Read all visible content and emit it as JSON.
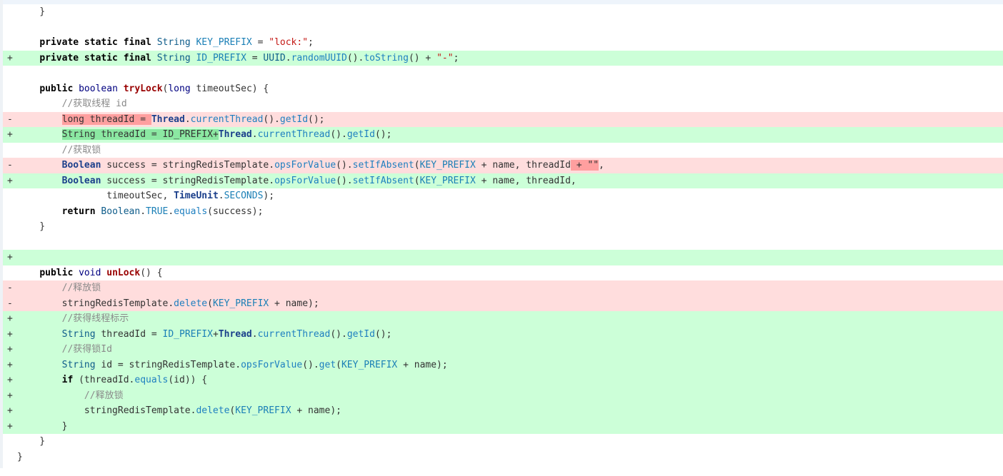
{
  "diff": {
    "lines": [
      {
        "type": "ctx",
        "sign": "",
        "tokens": [
          {
            "t": "    }"
          }
        ]
      },
      {
        "type": "ctx",
        "sign": "",
        "tokens": [
          {
            "t": ""
          }
        ]
      },
      {
        "type": "ctx",
        "sign": "",
        "tokens": [
          {
            "t": "    "
          },
          {
            "t": "private static final ",
            "c": "kw"
          },
          {
            "t": "String",
            "c": "ty"
          },
          {
            "t": " "
          },
          {
            "t": "KEY_PREFIX",
            "c": "cst"
          },
          {
            "t": " = "
          },
          {
            "t": "\"lock:\"",
            "c": "str"
          },
          {
            "t": ";"
          }
        ]
      },
      {
        "type": "add",
        "sign": "+",
        "tokens": [
          {
            "t": "    "
          },
          {
            "t": "private static final ",
            "c": "kw"
          },
          {
            "t": "String",
            "c": "ty"
          },
          {
            "t": " "
          },
          {
            "t": "ID_PREFIX",
            "c": "cst"
          },
          {
            "t": " = "
          },
          {
            "t": "UUID",
            "c": "ty"
          },
          {
            "t": "."
          },
          {
            "t": "randomUUID",
            "c": "mth"
          },
          {
            "t": "()."
          },
          {
            "t": "toString",
            "c": "mth"
          },
          {
            "t": "() + "
          },
          {
            "t": "\"-\"",
            "c": "str"
          },
          {
            "t": ";"
          }
        ]
      },
      {
        "type": "ctx",
        "sign": "",
        "tokens": [
          {
            "t": ""
          }
        ]
      },
      {
        "type": "ctx",
        "sign": "",
        "tokens": [
          {
            "t": "    "
          },
          {
            "t": "public ",
            "c": "kw"
          },
          {
            "t": "boolean",
            "c": "kwl"
          },
          {
            "t": " "
          },
          {
            "t": "tryLock",
            "c": "fn"
          },
          {
            "t": "("
          },
          {
            "t": "long",
            "c": "kwl"
          },
          {
            "t": " timeoutSec) {"
          }
        ]
      },
      {
        "type": "ctx",
        "sign": "",
        "tokens": [
          {
            "t": "        "
          },
          {
            "t": "//获取线程 id",
            "c": "cmt"
          }
        ]
      },
      {
        "type": "del",
        "sign": "-",
        "tokens": [
          {
            "t": "        "
          },
          {
            "t": "long threadId = ",
            "c": "hl-del"
          },
          {
            "t": "Thread",
            "c": "cls"
          },
          {
            "t": "."
          },
          {
            "t": "currentThread",
            "c": "mth"
          },
          {
            "t": "()."
          },
          {
            "t": "getId",
            "c": "mth"
          },
          {
            "t": "();"
          }
        ]
      },
      {
        "type": "add",
        "sign": "+",
        "tokens": [
          {
            "t": "        "
          },
          {
            "t": "String threadId = ID_PREFIX+",
            "c": "hl-add"
          },
          {
            "t": "Thread",
            "c": "cls"
          },
          {
            "t": "."
          },
          {
            "t": "currentThread",
            "c": "mth"
          },
          {
            "t": "()."
          },
          {
            "t": "getId",
            "c": "mth"
          },
          {
            "t": "();"
          }
        ]
      },
      {
        "type": "ctx",
        "sign": "",
        "tokens": [
          {
            "t": "        "
          },
          {
            "t": "//获取锁",
            "c": "cmt"
          }
        ]
      },
      {
        "type": "del",
        "sign": "-",
        "tokens": [
          {
            "t": "        "
          },
          {
            "t": "Boolean",
            "c": "cls"
          },
          {
            "t": " success = stringRedisTemplate."
          },
          {
            "t": "opsForValue",
            "c": "mth"
          },
          {
            "t": "()."
          },
          {
            "t": "setIfAbsent",
            "c": "mth"
          },
          {
            "t": "("
          },
          {
            "t": "KEY_PREFIX",
            "c": "cst"
          },
          {
            "t": " + name, threadId"
          },
          {
            "t": " + \"\"",
            "c": "hl-del"
          },
          {
            "t": ","
          }
        ]
      },
      {
        "type": "add",
        "sign": "+",
        "tokens": [
          {
            "t": "        "
          },
          {
            "t": "Boolean",
            "c": "cls"
          },
          {
            "t": " success = stringRedisTemplate."
          },
          {
            "t": "opsForValue",
            "c": "mth"
          },
          {
            "t": "()."
          },
          {
            "t": "setIfAbsent",
            "c": "mth"
          },
          {
            "t": "("
          },
          {
            "t": "KEY_PREFIX",
            "c": "cst"
          },
          {
            "t": " + name, threadId,"
          }
        ]
      },
      {
        "type": "ctx",
        "sign": "",
        "tokens": [
          {
            "t": "                timeoutSec, "
          },
          {
            "t": "TimeUnit",
            "c": "cls"
          },
          {
            "t": "."
          },
          {
            "t": "SECONDS",
            "c": "cst"
          },
          {
            "t": ");"
          }
        ]
      },
      {
        "type": "ctx",
        "sign": "",
        "tokens": [
          {
            "t": "        "
          },
          {
            "t": "return ",
            "c": "kw"
          },
          {
            "t": "Boolean",
            "c": "ty"
          },
          {
            "t": "."
          },
          {
            "t": "TRUE",
            "c": "cst"
          },
          {
            "t": "."
          },
          {
            "t": "equals",
            "c": "mth"
          },
          {
            "t": "(success);"
          }
        ]
      },
      {
        "type": "ctx",
        "sign": "",
        "tokens": [
          {
            "t": "    }"
          }
        ]
      },
      {
        "type": "ctx",
        "sign": "",
        "tokens": [
          {
            "t": ""
          }
        ]
      },
      {
        "type": "add",
        "sign": "+",
        "tokens": [
          {
            "t": ""
          }
        ]
      },
      {
        "type": "ctx",
        "sign": "",
        "tokens": [
          {
            "t": "    "
          },
          {
            "t": "public ",
            "c": "kw"
          },
          {
            "t": "void",
            "c": "kwl"
          },
          {
            "t": " "
          },
          {
            "t": "unLock",
            "c": "fn"
          },
          {
            "t": "() {"
          }
        ]
      },
      {
        "type": "del",
        "sign": "-",
        "tokens": [
          {
            "t": "        "
          },
          {
            "t": "//释放锁",
            "c": "cmt"
          }
        ]
      },
      {
        "type": "del",
        "sign": "-",
        "tokens": [
          {
            "t": "        stringRedisTemplate."
          },
          {
            "t": "delete",
            "c": "mth"
          },
          {
            "t": "("
          },
          {
            "t": "KEY_PREFIX",
            "c": "cst"
          },
          {
            "t": " + name);"
          }
        ]
      },
      {
        "type": "add",
        "sign": "+",
        "tokens": [
          {
            "t": "        "
          },
          {
            "t": "//获得线程标示",
            "c": "cmt"
          }
        ]
      },
      {
        "type": "add",
        "sign": "+",
        "tokens": [
          {
            "t": "        "
          },
          {
            "t": "String",
            "c": "ty"
          },
          {
            "t": " threadId = "
          },
          {
            "t": "ID_PREFIX",
            "c": "cst"
          },
          {
            "t": "+"
          },
          {
            "t": "Thread",
            "c": "cls"
          },
          {
            "t": "."
          },
          {
            "t": "currentThread",
            "c": "mth"
          },
          {
            "t": "()."
          },
          {
            "t": "getId",
            "c": "mth"
          },
          {
            "t": "();"
          }
        ]
      },
      {
        "type": "add",
        "sign": "+",
        "tokens": [
          {
            "t": "        "
          },
          {
            "t": "//获得锁Id",
            "c": "cmt"
          }
        ]
      },
      {
        "type": "add",
        "sign": "+",
        "tokens": [
          {
            "t": "        "
          },
          {
            "t": "String",
            "c": "ty"
          },
          {
            "t": " id = stringRedisTemplate."
          },
          {
            "t": "opsForValue",
            "c": "mth"
          },
          {
            "t": "()."
          },
          {
            "t": "get",
            "c": "mth"
          },
          {
            "t": "("
          },
          {
            "t": "KEY_PREFIX",
            "c": "cst"
          },
          {
            "t": " + name);"
          }
        ]
      },
      {
        "type": "add",
        "sign": "+",
        "tokens": [
          {
            "t": "        "
          },
          {
            "t": "if",
            "c": "kw"
          },
          {
            "t": " (threadId."
          },
          {
            "t": "equals",
            "c": "mth"
          },
          {
            "t": "(id)) {"
          }
        ]
      },
      {
        "type": "add",
        "sign": "+",
        "tokens": [
          {
            "t": "            "
          },
          {
            "t": "//释放锁",
            "c": "cmt"
          }
        ]
      },
      {
        "type": "add",
        "sign": "+",
        "tokens": [
          {
            "t": "            stringRedisTemplate."
          },
          {
            "t": "delete",
            "c": "mth"
          },
          {
            "t": "("
          },
          {
            "t": "KEY_PREFIX",
            "c": "cst"
          },
          {
            "t": " + name);"
          }
        ]
      },
      {
        "type": "add",
        "sign": "+",
        "tokens": [
          {
            "t": "        }"
          }
        ]
      },
      {
        "type": "ctx",
        "sign": "",
        "tokens": [
          {
            "t": "    }"
          }
        ]
      },
      {
        "type": "ctx",
        "sign": "",
        "tokens": [
          {
            "t": "}"
          }
        ]
      }
    ]
  }
}
